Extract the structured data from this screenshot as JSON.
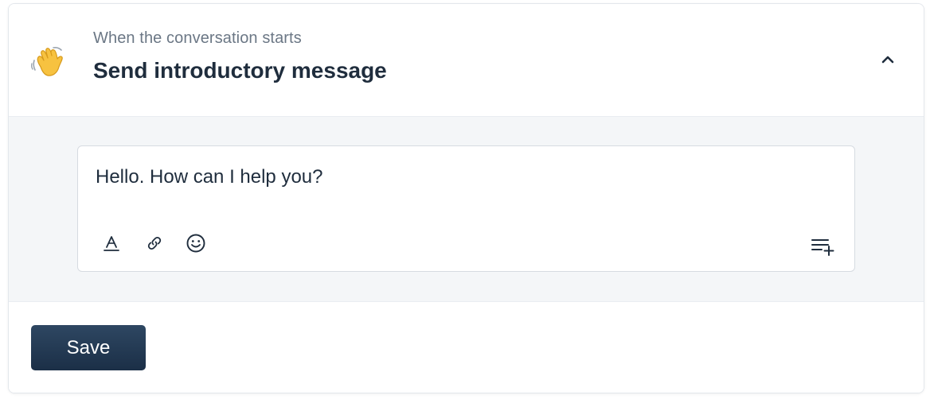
{
  "header": {
    "subtitle": "When the conversation starts",
    "title": "Send introductory message",
    "icon": "waving-hand-icon",
    "collapse_icon": "chevron-up-icon"
  },
  "editor": {
    "value": "Hello. How can I help you?",
    "toolbar": {
      "format_icon": "text-format-icon",
      "link_icon": "link-icon",
      "emoji_icon": "emoji-icon",
      "insert_icon": "insert-variable-icon"
    }
  },
  "footer": {
    "save_label": "Save"
  },
  "colors": {
    "primary_button": "#1f3550",
    "panel_bg": "#f4f6f8",
    "text": "#1f2d3d",
    "muted_text": "#6b7785",
    "wave_emoji": "#f7c240"
  }
}
